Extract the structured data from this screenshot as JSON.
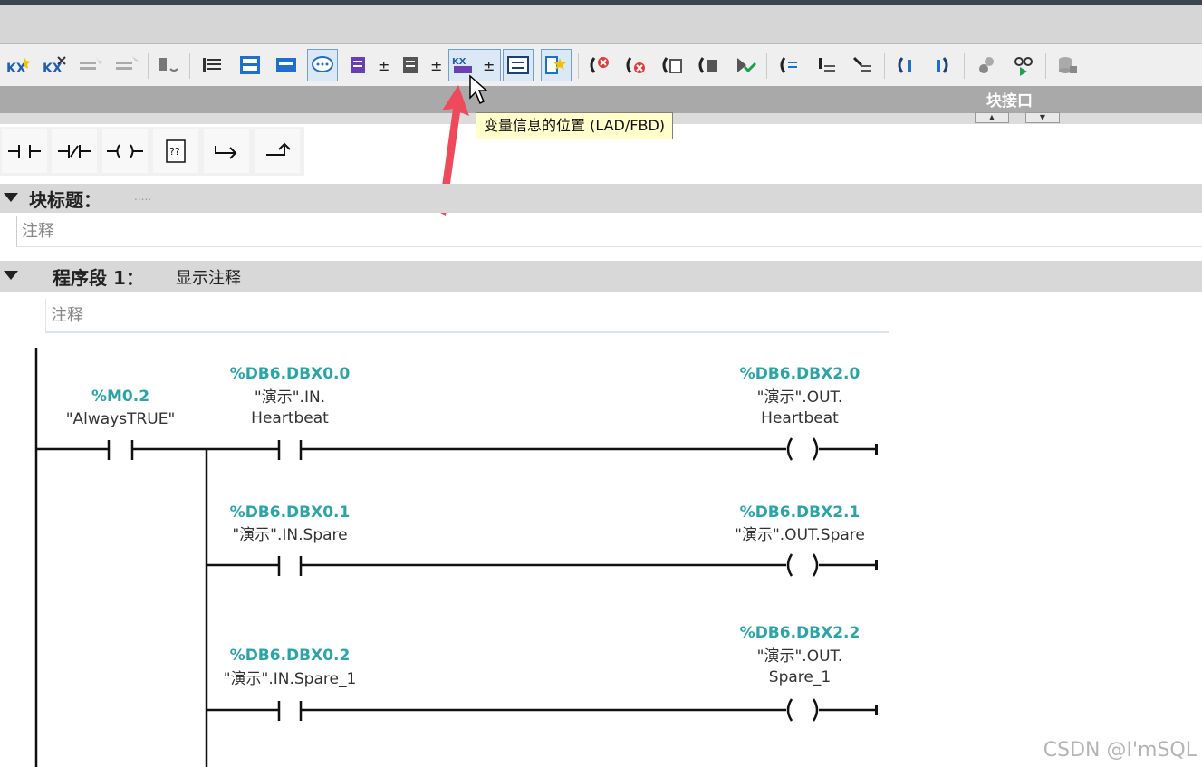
{
  "toolbar": {
    "icons": [
      "insert-network-icon",
      "delete-network-icon",
      "insert-row-icon",
      "add-row-icon",
      "call-icon",
      "network-view-icon",
      "collapse-icon",
      "expand-icon",
      "comments-icon",
      "absolute-info-icon",
      "tag-info-icon",
      "variable-position-icon",
      "list-icon",
      "favorites-icon",
      "monitor-off-icon",
      "go-offline-icon",
      "monitor-all-icon",
      "monitor-on-icon",
      "download-icon",
      "first-icon",
      "jump-icon",
      "next-icon",
      "back-icon",
      "forward-icon",
      "cross-ref-icon",
      "monitor-glasses-icon",
      "db-icon"
    ],
    "tooltip": "变量信息的位置 (LAD/FBD)",
    "block_interface_label": "块接口"
  },
  "elements": {
    "items": [
      "normally-open-contact",
      "normally-closed-contact",
      "coil",
      "empty-box",
      "open-branch",
      "close-branch"
    ]
  },
  "block": {
    "title_label": "块标题：",
    "title_dots": ".....",
    "comment": "注释"
  },
  "network": {
    "label": "程序段 1：",
    "title": "显示注释",
    "comment": "注释",
    "main_contact": {
      "address": "%M0.2",
      "symbol": "\"AlwaysTRUE\""
    },
    "rungs": [
      {
        "in_address": "%DB6.DBX0.0",
        "in_symbol_1": "\"演示\".IN.",
        "in_symbol_2": "Heartbeat",
        "out_address": "%DB6.DBX2.0",
        "out_symbol_1": "\"演示\".OUT.",
        "out_symbol_2": "Heartbeat"
      },
      {
        "in_address": "%DB6.DBX0.1",
        "in_symbol_1": "\"演示\".IN.Spare",
        "out_address": "%DB6.DBX2.1",
        "out_symbol_1": "\"演示\".OUT.Spare"
      },
      {
        "in_address": "%DB6.DBX0.2",
        "in_symbol_1": "\"演示\".IN.Spare_1",
        "out_address": "%DB6.DBX2.2",
        "out_symbol_1": "\"演示\".OUT.",
        "out_symbol_2": "Spare_1"
      }
    ]
  },
  "watermark": "CSDN @I'mSQL",
  "colors": {
    "accent_tag": "#2ba4a8",
    "arrow": "#ef4a5c",
    "tooltip_bg": "#ffffcc"
  }
}
